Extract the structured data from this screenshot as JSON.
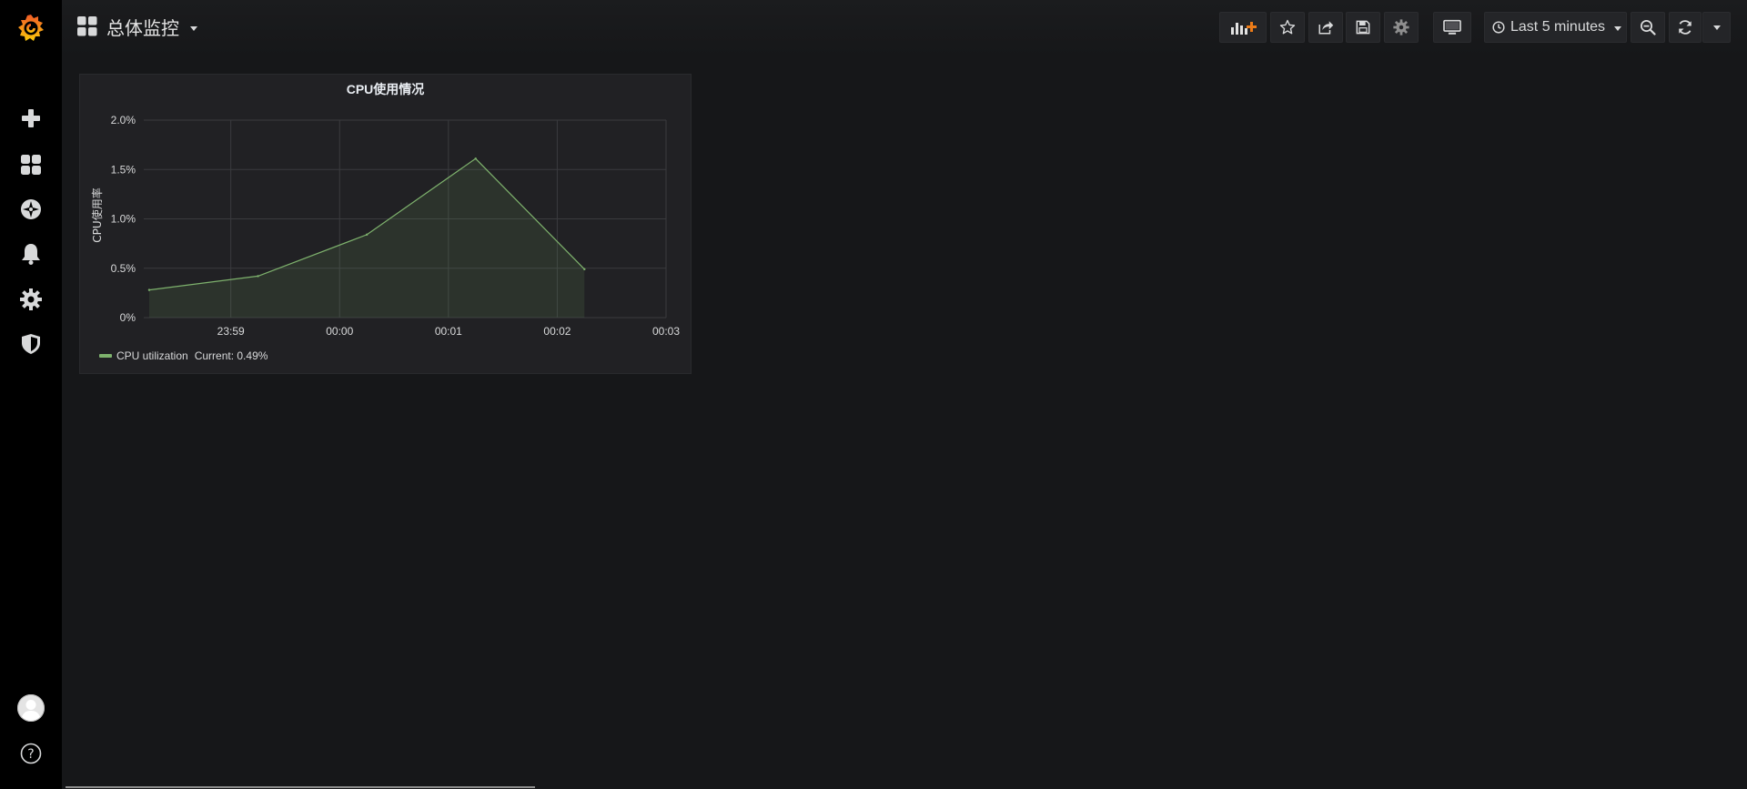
{
  "sidebar": {
    "items": [
      {
        "icon": "grafana-logo-icon"
      },
      {
        "icon": "plus-icon"
      },
      {
        "icon": "dashboards-icon"
      },
      {
        "icon": "explore-compass-icon"
      },
      {
        "icon": "alert-bell-icon"
      },
      {
        "icon": "gear-icon"
      },
      {
        "icon": "shield-icon"
      },
      {
        "icon": "user-avatar-icon"
      },
      {
        "icon": "help-icon"
      }
    ]
  },
  "header": {
    "dashboard_title": "总体监控",
    "time_range_label": "Last 5 minutes",
    "buttons": [
      "add-panel",
      "star",
      "share",
      "save",
      "settings",
      "tv-mode",
      "time-picker",
      "zoom-out",
      "refresh",
      "refresh-interval"
    ]
  },
  "panel": {
    "title": "CPU使用情况",
    "legend": {
      "series_name": "CPU utilization",
      "current_label": "Current: 0.49%"
    }
  },
  "chart_data": {
    "type": "area",
    "title": "CPU使用情况",
    "xlabel": "",
    "ylabel": "CPU使用率",
    "x_tick_labels": [
      "23:59",
      "00:00",
      "00:01",
      "00:02",
      "00:03"
    ],
    "y_tick_labels": [
      "0%",
      "0.5%",
      "1.0%",
      "1.5%",
      "2.0%"
    ],
    "ylim": [
      0,
      2.0
    ],
    "xlim": [
      "23:58:12",
      "00:03:00"
    ],
    "grid": true,
    "legend_position": "bottom-left",
    "series": [
      {
        "name": "CPU utilization",
        "color": "#7eb26d",
        "x": [
          "23:58:15",
          "23:59:15",
          "00:00:15",
          "00:01:15",
          "00:02:15"
        ],
        "y": [
          0.28,
          0.42,
          0.84,
          1.61,
          0.49
        ]
      }
    ]
  },
  "colors": {
    "background": "#161719",
    "sidebar": "#000000",
    "panel": "#212124",
    "series": "#7eb26d",
    "logo_orange": "#f05a28",
    "logo_yellow": "#fbca0a"
  }
}
